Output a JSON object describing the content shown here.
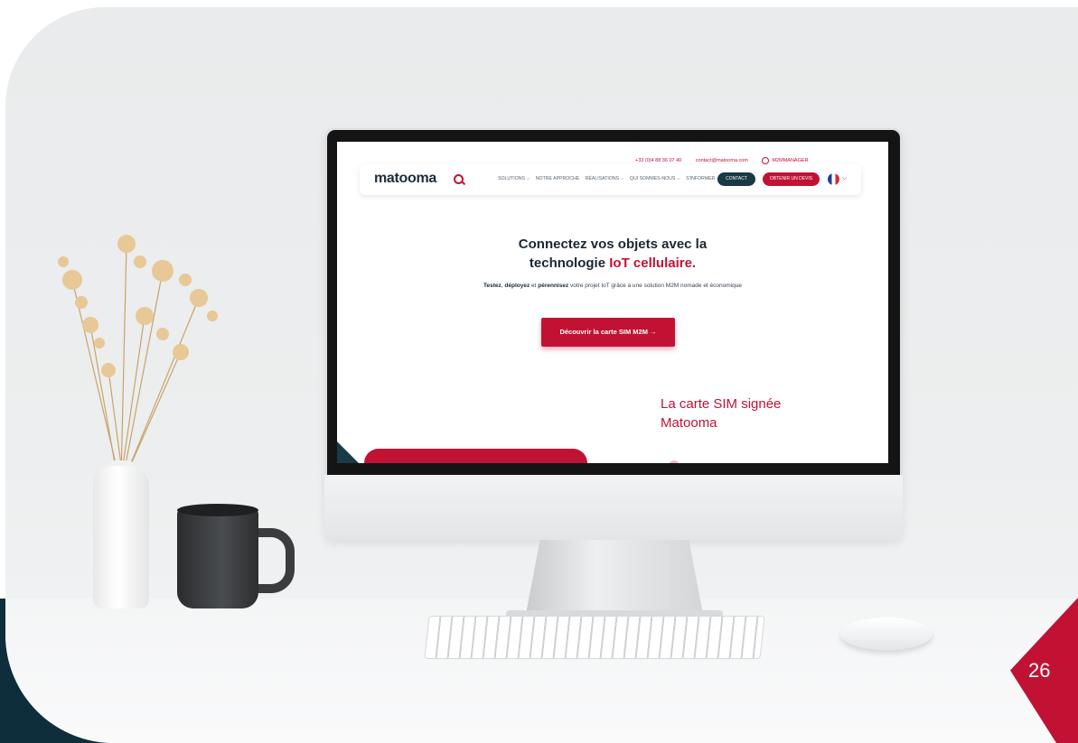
{
  "screen": {
    "topbar": {
      "phone": "+33 (0)4 88 36 07 40",
      "email": "contact@matooma.com",
      "account_label": "M2MMANAGER"
    },
    "navbar": {
      "logo": "matooma",
      "links": [
        "SOLUTIONS ⌵",
        "NOTRE APPROCHE",
        "RÉALISATIONS ⌵",
        "QUI SOMMES-NOUS ⌵",
        "S'INFORMER ⌵"
      ],
      "contact_label": "CONTACT",
      "quote_label": "OBTENIR UN DEVIS",
      "language_icon": "french-flag-icon"
    },
    "hero": {
      "title_line1": "Connectez vos objets avec la",
      "title_line2_prefix": "technologie ",
      "title_line2_accent": "IoT cellulaire.",
      "subtitle_bold1": "Testez",
      "subtitle_sep1": ", ",
      "subtitle_bold2": "déployez",
      "subtitle_sep2": " et ",
      "subtitle_bold3": "pérennisez",
      "subtitle_rest": " votre projet IoT grâce à une solution M2M nomade et économique",
      "cta_label": "Découvrir la carte SIM M2M →"
    },
    "section_title": "La carte SIM signée Matooma"
  },
  "page_number": "26",
  "colors": {
    "brand_red": "#c21234",
    "brand_dark": "#173a46"
  }
}
